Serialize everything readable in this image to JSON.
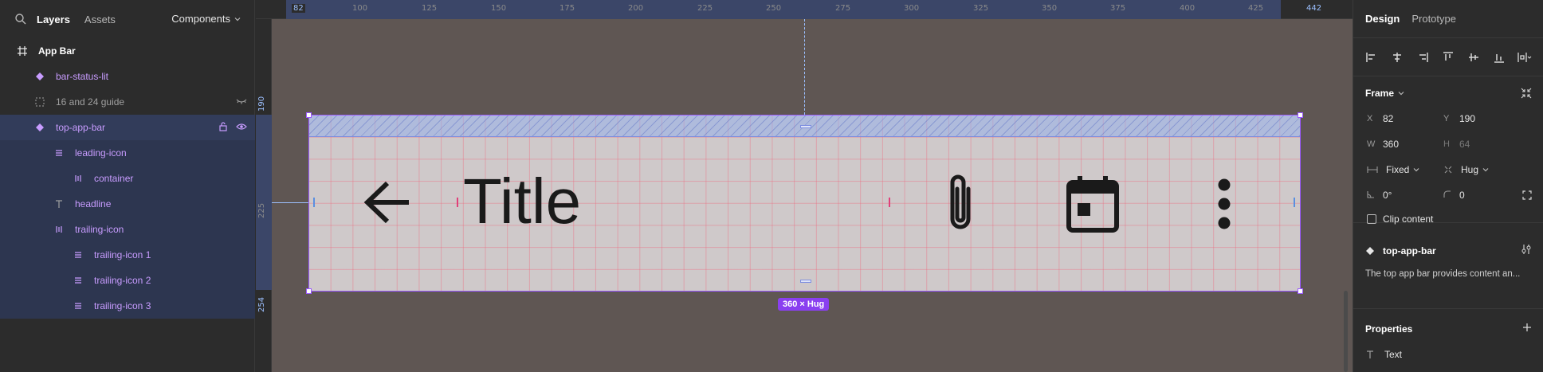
{
  "left_panel": {
    "tabs": [
      {
        "label": "Layers"
      },
      {
        "label": "Assets"
      }
    ],
    "components_label": "Components",
    "layers": [
      {
        "label": "App Bar",
        "icon": "frame-hash-icon",
        "style": "white",
        "indent": 0
      },
      {
        "label": "bar-status-lit",
        "icon": "component-instance-icon",
        "style": "purple",
        "indent": 1
      },
      {
        "label": "16 and 24 guide",
        "icon": "dashed-frame-icon",
        "style": "grey",
        "indent": 1
      },
      {
        "label": "top-app-bar",
        "icon": "component-instance-icon",
        "style": "purple",
        "indent": 1
      },
      {
        "label": "leading-icon",
        "icon": "auto-layout-horizontal-icon",
        "style": "purple",
        "indent": 2
      },
      {
        "label": "container",
        "icon": "auto-layout-vertical-icon",
        "style": "purple",
        "indent": 3
      },
      {
        "label": "headline",
        "icon": "text-icon",
        "style": "purple",
        "indent": 2
      },
      {
        "label": "trailing-icon",
        "icon": "auto-layout-vertical-icon",
        "style": "purple",
        "indent": 2
      },
      {
        "label": "trailing-icon 1",
        "icon": "auto-layout-horizontal-icon",
        "style": "purple",
        "indent": 3
      },
      {
        "label": "trailing-icon 2",
        "icon": "auto-layout-horizontal-icon",
        "style": "purple",
        "indent": 3
      },
      {
        "label": "trailing-icon 3",
        "icon": "auto-layout-horizontal-icon",
        "style": "purple",
        "indent": 3
      }
    ]
  },
  "canvas": {
    "ruler_top": [
      "82",
      "100",
      "125",
      "150",
      "175",
      "200",
      "225",
      "250",
      "275",
      "300",
      "325",
      "350",
      "375",
      "400",
      "425",
      "442"
    ],
    "ruler_left": [
      "190",
      "225",
      "254"
    ],
    "frame_title": "Title",
    "size_badge": "360 × Hug",
    "colors": {
      "selection": "#9b59ff",
      "canvas_bg": "#5f5653",
      "grid": "#eb6e82"
    }
  },
  "right_panel": {
    "tabs": [
      {
        "label": "Design"
      },
      {
        "label": "Prototype"
      }
    ],
    "frame": {
      "title": "Frame",
      "x_label": "X",
      "x": "82",
      "y_label": "Y",
      "y": "190",
      "w_label": "W",
      "w": "360",
      "h_label": "H",
      "h": "64",
      "width_mode": "Fixed",
      "height_mode": "Hug",
      "rotation": "0°",
      "radius": "0",
      "clip_content": "Clip content"
    },
    "component": {
      "name": "top-app-bar",
      "description": "The top app bar provides content an..."
    },
    "properties": {
      "title": "Properties",
      "items": [
        {
          "label": "Text"
        }
      ]
    }
  }
}
